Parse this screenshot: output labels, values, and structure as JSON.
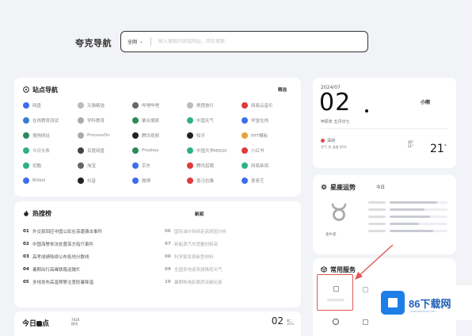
{
  "header": {
    "logo": "夸克导航",
    "search_scope": "全网",
    "search_placeholder": "输入搜索内容或网址，回车搜索"
  },
  "sites": {
    "title": "站点导航",
    "tabs": [
      "精选",
      ""
    ],
    "items": [
      {
        "label": "网盘",
        "color": "#3e6df2"
      },
      {
        "label": "天猫精选",
        "color": "#bbbbbb"
      },
      {
        "label": "哔哩哔哩",
        "color": "#666666"
      },
      {
        "label": "携程旅行",
        "color": "#bbbbbb"
      },
      {
        "label": "网易云音乐",
        "color": "#e03b3b"
      },
      {
        "label": "在线教育测试",
        "color": "#3a7bd5"
      },
      {
        "label": "学科教育",
        "color": "#aaaaaa"
      },
      {
        "label": "聚合搜索",
        "color": "#2a8a5a"
      },
      {
        "label": "中国天气",
        "color": "#2db380"
      },
      {
        "label": "学堂在线",
        "color": "#3e6df2"
      },
      {
        "label": "搜狗网址",
        "color": "#2a8a5a"
      },
      {
        "label": "ProcessOn",
        "color": "#aaaaaa"
      },
      {
        "label": "腾讯视频",
        "color": "#222222"
      },
      {
        "label": "知乎",
        "color": "#222222"
      },
      {
        "label": "PPT模板",
        "color": "#e6a23c"
      },
      {
        "label": "今日头条",
        "color": "#2db380"
      },
      {
        "label": "百度网盘",
        "color": "#444444"
      },
      {
        "label": "Pixabay",
        "color": "#2a8a5a"
      },
      {
        "label": "中国大学MOOC",
        "color": "#2db380"
      },
      {
        "label": "小红书",
        "color": "#e03b3b"
      },
      {
        "label": "优酷",
        "color": "#2db380"
      },
      {
        "label": "淘宝",
        "color": "#666666"
      },
      {
        "label": "京东",
        "color": "#3e6df2"
      },
      {
        "label": "腾讯招聘",
        "color": "#e03b3b"
      },
      {
        "label": "网易新闻",
        "color": "#2db380"
      },
      {
        "label": "Bilibili",
        "color": "#3e6df2"
      },
      {
        "label": "抖音",
        "color": "#222222"
      },
      {
        "label": "微博",
        "color": "#3e6df2"
      },
      {
        "label": "喜马拉雅",
        "color": "#e03b3b"
      },
      {
        "label": "爱奇艺",
        "color": "#3e6df2"
      }
    ]
  },
  "hot": {
    "title": "热搜榜",
    "tabs": [
      "新闻",
      "",
      "",
      "",
      "",
      ""
    ],
    "left": [
      {
        "rank": "01",
        "title": "外交部回应中国公民在菲遭袭击事件"
      },
      {
        "rank": "02",
        "title": "中国海警依法处置菲方船只事件"
      },
      {
        "rank": "03",
        "title": "高考成绩陆续公布各地分数线"
      },
      {
        "rank": "04",
        "title": "暑期出行高峰铁路运输忙"
      },
      {
        "rank": "05",
        "title": "多地发布高温预警注意防暑降温"
      }
    ],
    "right": [
      {
        "rank": "06",
        "title": "国际油价持续走高原因分析"
      },
      {
        "rank": "07",
        "title": "新能源汽车销量创新高"
      },
      {
        "rank": "08",
        "title": "科学家发现新型材料"
      },
      {
        "rank": "09",
        "title": "全国多地迎来强降雨天气"
      },
      {
        "rank": "10",
        "title": "暑期档电影票房突破纪录"
      }
    ]
  },
  "daily": {
    "brand_a": "今日",
    "brand_b": "点",
    "tiny_a": "7X24",
    "tiny_b": "快讯",
    "num": "02",
    "sub_a": "周二",
    "sub_b": "2024"
  },
  "date": {
    "ym": "2024/07",
    "day": "02",
    "lunar": "甲辰年 五月廿七",
    "cond": "小雨",
    "loc": "深圳",
    "extra": "空气 良  湿度 85%",
    "hi": "26°",
    "lo": "21°",
    "temp": "21",
    "deg": "°"
  },
  "horo": {
    "title": "星座运势",
    "tabs": [
      "今日",
      "",
      "",
      ""
    ],
    "sign": "金牛座",
    "levels": [
      0.82,
      0.6,
      0.7,
      0.5,
      0.75
    ]
  },
  "services": {
    "title": "常用服务"
  },
  "watermark": {
    "text": "86下载网",
    "url": "www.86xiazai.com"
  },
  "colors": {
    "accent": "#e25555",
    "brand": "#1e7ee8"
  }
}
